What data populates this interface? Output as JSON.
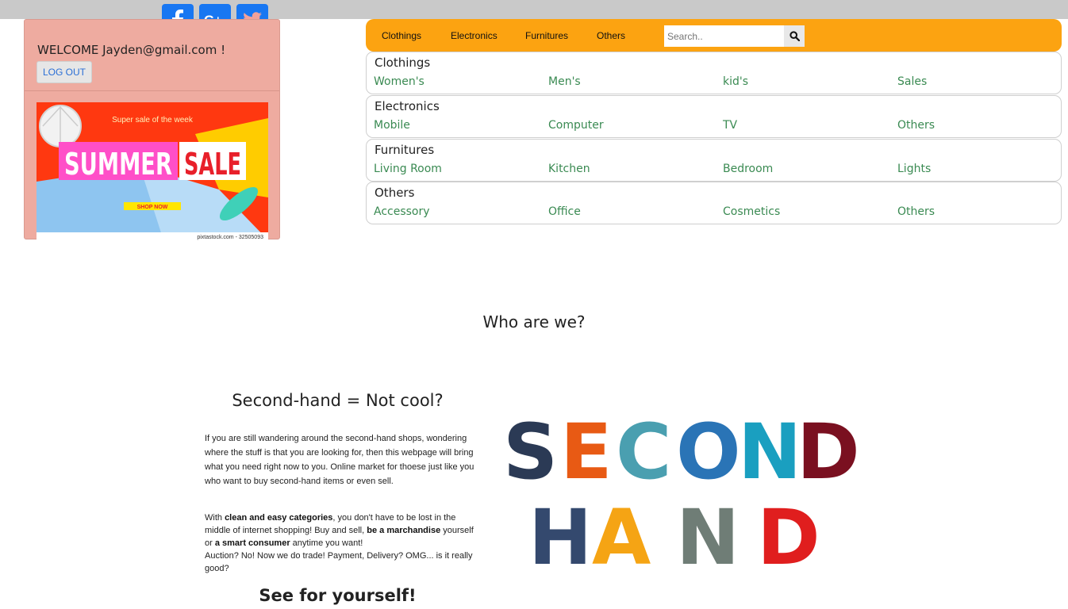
{
  "social": [
    {
      "name": "facebook-icon",
      "glyph": "f"
    },
    {
      "name": "google-plus-icon",
      "glyph": "G+"
    },
    {
      "name": "twitter-icon",
      "glyph": "t"
    }
  ],
  "user": {
    "welcome": "WELCOME Jayden@gmail.com !",
    "logout_label": "LOG OUT"
  },
  "banner": {
    "tagline": "Super sale of the week",
    "word1": "SUMMER",
    "word2": "SALE",
    "cta": "SHOP NOW",
    "credit": "pixtastock.com - 32505093"
  },
  "nav": {
    "items": [
      "Clothings",
      "Electronics",
      "Furnitures",
      "Others"
    ],
    "search_placeholder": "Search.."
  },
  "categories": [
    {
      "title": "Clothings",
      "links": [
        "Women's",
        "Men's",
        "kid's",
        "Sales"
      ]
    },
    {
      "title": "Electronics",
      "links": [
        "Mobile",
        "Computer",
        "TV",
        "Others"
      ]
    },
    {
      "title": "Furnitures",
      "links": [
        "Living Room",
        "Kitchen",
        "Bedroom",
        "Lights"
      ]
    },
    {
      "title": "Others",
      "links": [
        "Accessory",
        "Office",
        "Cosmetics",
        "Others"
      ]
    }
  ],
  "about": {
    "heading": "Who are we?",
    "subheading": "Second-hand = Not cool?",
    "para1": "If you are still wandering around the second-hand shops, wondering where the stuff is that you are looking for, then this webpage will bring what you need right now to you. Online market for thoese just like you who want to buy second-hand items or even sell.",
    "para2_a": "With ",
    "para2_b1": "clean and easy categories",
    "para2_c": ", you don't have to be lost in the middle of internet shopping! Buy and sell, ",
    "para2_b2": "be a marchandise",
    "para2_d": " yourself or ",
    "para2_b3": "a smart consumer",
    "para2_e": " anytime you want!",
    "para3": "Auction? No! Now we do trade! Payment, Delivery? OMG... is it really good?",
    "cta_heading": "See for yourself!",
    "art_line1": "SECOND",
    "art_line2": "HAND"
  },
  "colors": {
    "nav_bg": "#fca311",
    "panel_bg": "#eeaba0",
    "link_green": "#3a8a52",
    "social_blue": "#1877f2"
  }
}
